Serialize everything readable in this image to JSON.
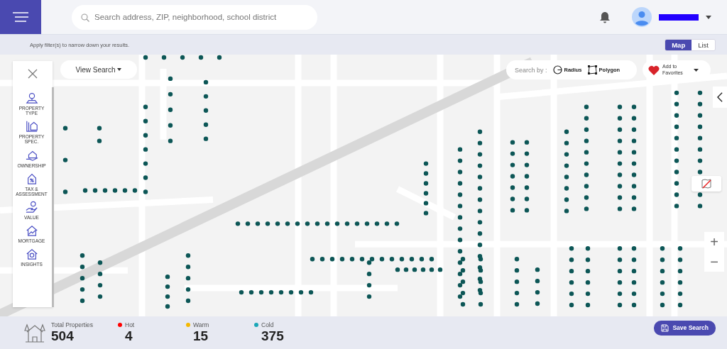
{
  "header": {
    "search": {
      "placeholder": "Search address, ZIP, neighborhood, school district"
    }
  },
  "filter_hint": "Apply filter(s) to narrow down your results.",
  "view_toggle": [
    {
      "label": "Map",
      "selected": true
    },
    {
      "label": "List",
      "selected": false
    }
  ],
  "map": {
    "view_search": "View Search",
    "search_by": {
      "label": "Search by :",
      "options": [
        {
          "label": "Radius",
          "kind": "radius"
        },
        {
          "label": "Polygon",
          "kind": "polygon"
        }
      ]
    },
    "favorites": "Add to Favorites",
    "zoom": [
      "+",
      "−"
    ]
  },
  "filters": [
    {
      "label": "PROPERTY TYPE",
      "kind": "type"
    },
    {
      "label": "PROPERTY SPEC.",
      "kind": "spec"
    },
    {
      "label": "OWNERSHIP",
      "kind": "ownership"
    },
    {
      "label": "TAX & ASSESSMENT",
      "kind": "tax"
    },
    {
      "label": "VALUE",
      "kind": "value"
    },
    {
      "label": "MORTGAGE",
      "kind": "mortgage"
    },
    {
      "label": "INSIGHTS",
      "kind": "insights"
    }
  ],
  "summary": {
    "total": {
      "label": "Total Properties",
      "value": "504"
    },
    "temps": [
      {
        "label": "Hot",
        "value": "4",
        "color": "#ff0000"
      },
      {
        "label": "Warm",
        "value": "15",
        "color": "#f5b800"
      },
      {
        "label": "Cold",
        "value": "375",
        "color": "#1aa6b7"
      }
    ]
  },
  "save_search": "Save Search"
}
